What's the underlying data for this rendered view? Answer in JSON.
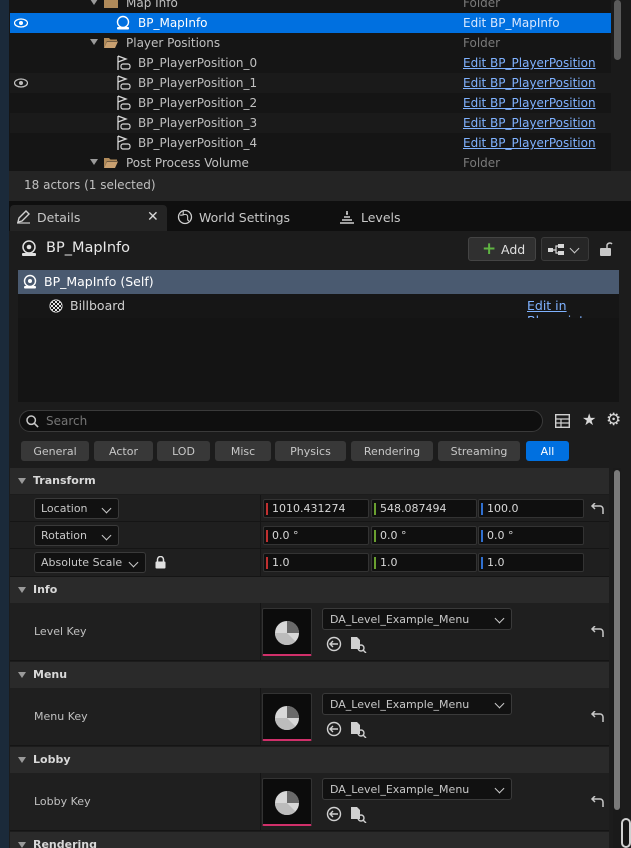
{
  "outliner": {
    "rows": [
      {
        "name": "Map Info",
        "type": "Folder"
      },
      {
        "name": "BP_MapInfo",
        "type": "Edit BP_MapInfo"
      },
      {
        "name": "Player Positions",
        "type": "Folder"
      },
      {
        "name": "BP_PlayerPosition_0",
        "type": "Edit BP_PlayerPosition"
      },
      {
        "name": "BP_PlayerPosition_1",
        "type": "Edit BP_PlayerPosition"
      },
      {
        "name": "BP_PlayerPosition_2",
        "type": "Edit BP_PlayerPosition"
      },
      {
        "name": "BP_PlayerPosition_3",
        "type": "Edit BP_PlayerPosition"
      },
      {
        "name": "BP_PlayerPosition_4",
        "type": "Edit BP_PlayerPosition"
      },
      {
        "name": "Post Process Volume",
        "type": "Folder"
      }
    ],
    "status": "18 actors (1 selected)"
  },
  "tabs": {
    "details": "Details",
    "world_settings": "World Settings",
    "levels": "Levels"
  },
  "details": {
    "actor_name": "BP_MapInfo",
    "add_label": "Add",
    "components": {
      "self": "BP_MapInfo (Self)",
      "billboard": "Billboard",
      "edit_blueprint": "Edit in Blueprint"
    },
    "search_placeholder": "Search",
    "filters": [
      "General",
      "Actor",
      "LOD",
      "Misc",
      "Physics",
      "Rendering",
      "Streaming",
      "All"
    ],
    "active_filter": "All",
    "transform": {
      "header": "Transform",
      "location_label": "Location",
      "rotation_label": "Rotation",
      "scale_label": "Absolute Scale",
      "location": [
        "1010.431274",
        "548.087494",
        "100.0"
      ],
      "rotation": [
        "0.0 °",
        "0.0 °",
        "0.0 °"
      ],
      "scale": [
        "1.0",
        "1.0",
        "1.0"
      ]
    },
    "info": {
      "header": "Info",
      "label": "Level Key",
      "value": "DA_Level_Example_Menu"
    },
    "menu": {
      "header": "Menu",
      "label": "Menu Key",
      "value": "DA_Level_Example_Menu"
    },
    "lobby": {
      "header": "Lobby",
      "label": "Lobby Key",
      "value": "DA_Level_Example_Menu"
    },
    "rendering": {
      "header": "Rendering"
    }
  },
  "colors": {
    "selection": "#0070e0",
    "link": "#7fb2ff",
    "axis_x": "#c03030",
    "axis_y": "#6aa030",
    "axis_z": "#3070d0",
    "add_green": "#5fb442",
    "asset_underline": "#d0306a"
  }
}
